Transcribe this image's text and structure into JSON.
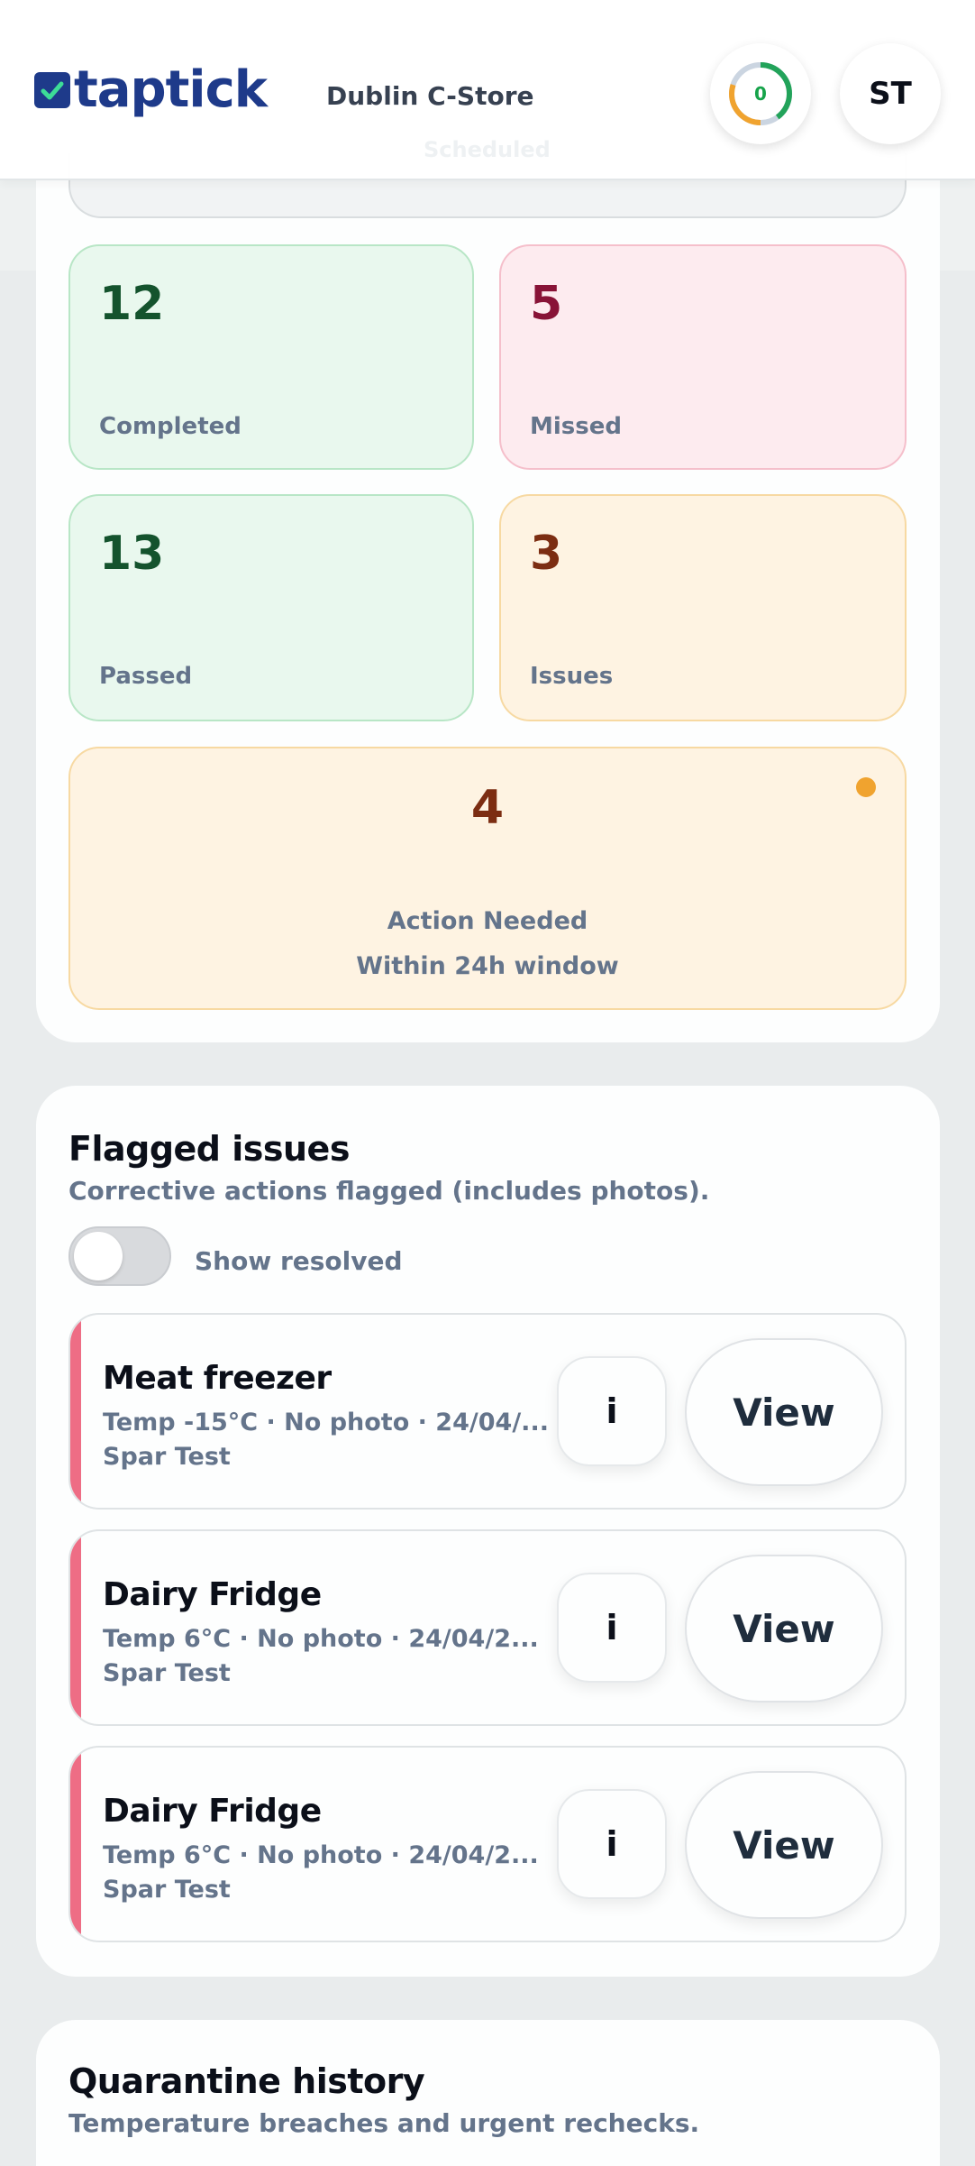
{
  "header": {
    "logo_text": "taptick",
    "store_name": "Dublin C-Store",
    "ghost_label": "Scheduled",
    "progress_value": "0",
    "progress_fraction": 0.5,
    "avatar_initials": "ST"
  },
  "summary": {
    "completed": {
      "value": "12",
      "label": "Completed"
    },
    "missed": {
      "value": "5",
      "label": "Missed"
    },
    "passed": {
      "value": "13",
      "label": "Passed"
    },
    "issues": {
      "value": "3",
      "label": "Issues"
    },
    "action": {
      "value": "4",
      "label": "Action Needed",
      "sublabel": "Within 24h window"
    }
  },
  "flagged": {
    "title": "Flagged issues",
    "subtitle": "Corrective actions flagged (includes photos).",
    "toggle_label": "Show resolved",
    "toggle_on": false,
    "info_label": "i",
    "view_label": "View",
    "items": [
      {
        "title": "Meat freezer",
        "meta": "Temp -15°C · No photo · 24/04/...",
        "store": "Spar Test"
      },
      {
        "title": "Dairy Fridge",
        "meta": "Temp 6°C · No photo · 24/04/2...",
        "store": "Spar Test"
      },
      {
        "title": "Dairy Fridge",
        "meta": "Temp 6°C · No photo · 24/04/2...",
        "store": "Spar Test"
      }
    ]
  },
  "quarantine": {
    "title": "Quarantine history",
    "subtitle": "Temperature breaches and urgent rechecks."
  },
  "colors": {
    "brand": "#1e3a8a",
    "completed_bg": "#e9f8ee",
    "missed_bg": "#fdebef",
    "issues_bg": "#fef3e2",
    "flag_bar": "#ee6d85"
  }
}
